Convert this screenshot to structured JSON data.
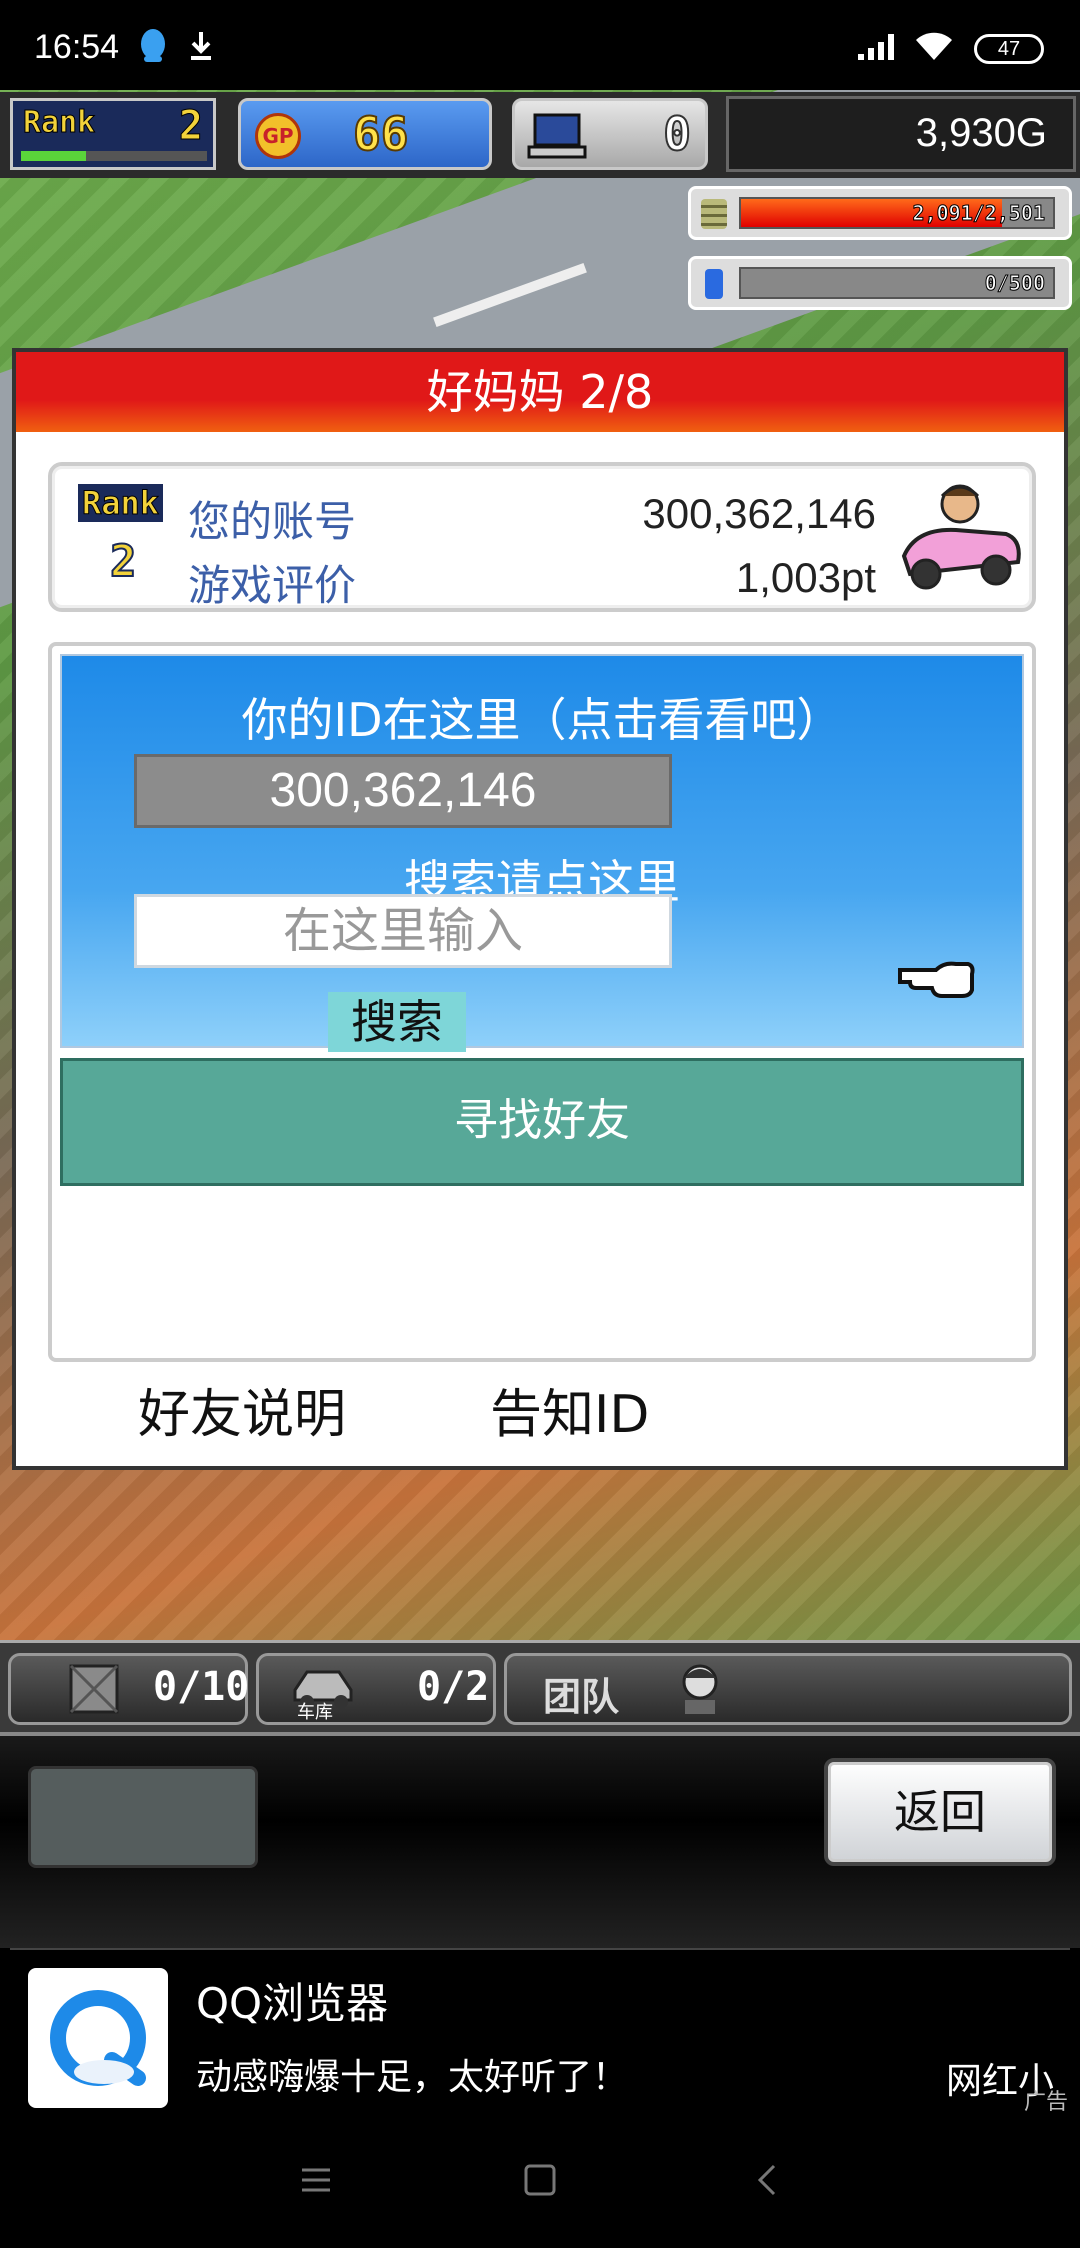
{
  "status_bar": {
    "time": "16:54",
    "battery": "47"
  },
  "hud": {
    "rank_label": "Rank",
    "rank_value": "2",
    "rank_progress": 0.35,
    "gp_label": "GP",
    "gp_value": "66",
    "computers_value": "0",
    "money": "3,930G",
    "resource1_text": "2,091/2,501",
    "resource1_fraction": 0.836,
    "resource2_text": "0/500",
    "resource2_fraction": 0.0
  },
  "dialog": {
    "title": "好妈妈 2/8",
    "info": {
      "rank_label": "Rank",
      "rank_value": "2",
      "account_label": "您的账号",
      "account_value": "300,362,146",
      "rating_label": "游戏评价",
      "rating_value": "1,003pt"
    },
    "your_id_label": "你的ID在这里（点击看看吧）",
    "your_id_value": "300,362,146",
    "search_hint": "搜索请点这里",
    "search_placeholder": "在这里输入",
    "search_button": "搜索",
    "find_friends_button": "寻找好友",
    "friend_help": "好友说明",
    "share_id": "告知ID"
  },
  "bottom_bar": {
    "items_value": "0/10",
    "garage_label": "车库",
    "garage_value": "0/2",
    "team_label": "团队"
  },
  "controls": {
    "back_button": "返回"
  },
  "ad": {
    "title": "QQ浏览器",
    "text": "动感嗨爆十足，太好听了！",
    "right_text": "网红小",
    "tag": "广告"
  },
  "colors": {
    "title_red": "#e01818",
    "panel_blue": "#1e8ae8",
    "find_green": "#57a898",
    "label_blue": "#3c5fa8"
  }
}
